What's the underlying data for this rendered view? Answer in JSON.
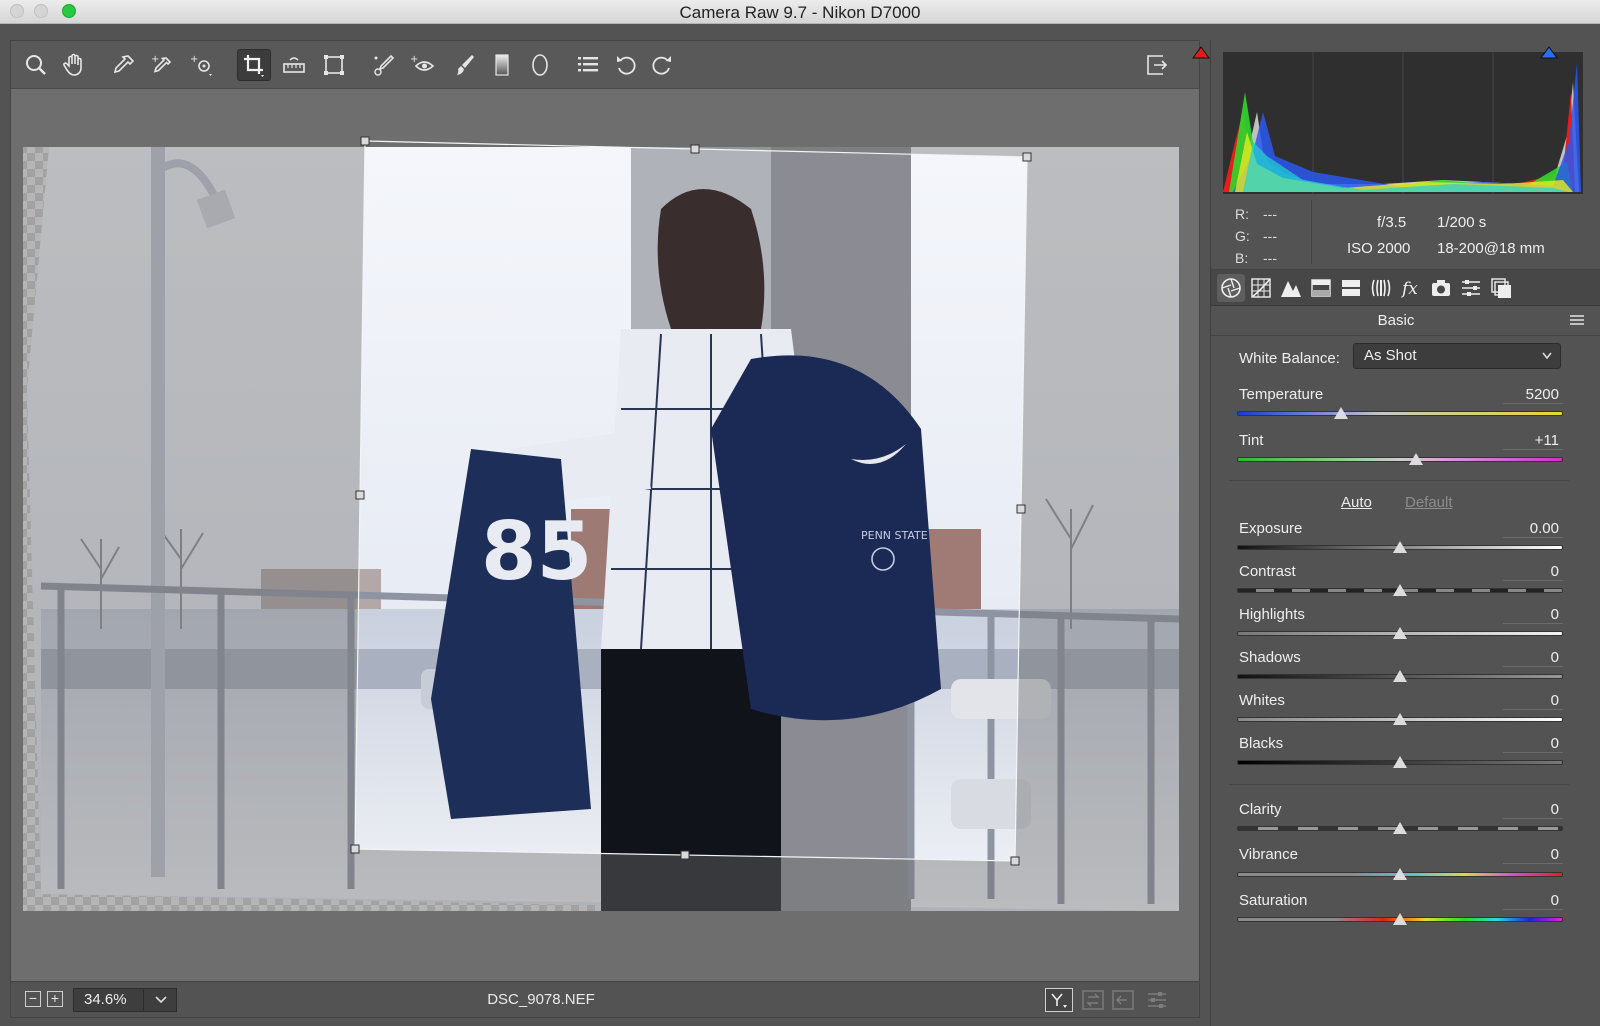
{
  "window": {
    "title": "Camera Raw 9.7  -  Nikon D7000"
  },
  "toolbar": {
    "tools": [
      "zoom-tool",
      "hand-tool",
      "white-balance-tool",
      "color-sampler-tool",
      "targeted-adjustment-tool",
      "crop-tool",
      "straighten-tool",
      "transform-tool",
      "spot-removal-tool",
      "red-eye-tool",
      "adjustment-brush-tool",
      "graduated-filter-tool",
      "radial-filter-tool",
      "preferences-tool",
      "rotate-ccw-tool",
      "rotate-cw-tool"
    ],
    "active_tool": "crop-tool"
  },
  "bottom": {
    "zoom_minus": "−",
    "zoom_plus": "+",
    "zoom": "34.6%",
    "filename": "DSC_9078.NEF"
  },
  "info": {
    "r_label": "R:",
    "r_value": "---",
    "g_label": "G:",
    "g_value": "---",
    "b_label": "B:",
    "b_value": "---",
    "aperture": "f/3.5",
    "shutter": "1/200 s",
    "iso": "ISO 2000",
    "lens": "18-200@18 mm"
  },
  "panel": {
    "title": "Basic",
    "white_balance_label": "White Balance:",
    "white_balance_value": "As Shot",
    "auto_label": "Auto",
    "default_label": "Default",
    "temperature": {
      "label": "Temperature",
      "value": "5200",
      "position": 0.32
    },
    "tint": {
      "label": "Tint",
      "value": "+11",
      "position": 0.55
    },
    "exposure": {
      "label": "Exposure",
      "value": "0.00",
      "position": 0.5
    },
    "contrast": {
      "label": "Contrast",
      "value": "0",
      "position": 0.5
    },
    "highlights": {
      "label": "Highlights",
      "value": "0",
      "position": 0.5
    },
    "shadows": {
      "label": "Shadows",
      "value": "0",
      "position": 0.5
    },
    "whites": {
      "label": "Whites",
      "value": "0",
      "position": 0.5
    },
    "blacks": {
      "label": "Blacks",
      "value": "0",
      "position": 0.5
    },
    "clarity": {
      "label": "Clarity",
      "value": "0",
      "position": 0.5
    },
    "vibrance": {
      "label": "Vibrance",
      "value": "0",
      "position": 0.5
    },
    "saturation": {
      "label": "Saturation",
      "value": "0",
      "position": 0.5
    }
  },
  "colors": {
    "accent": "#5b8fd6",
    "panel_bg": "#535353",
    "clip_shadow": "#e01c1c",
    "clip_highlight": "#2a6ef0"
  }
}
